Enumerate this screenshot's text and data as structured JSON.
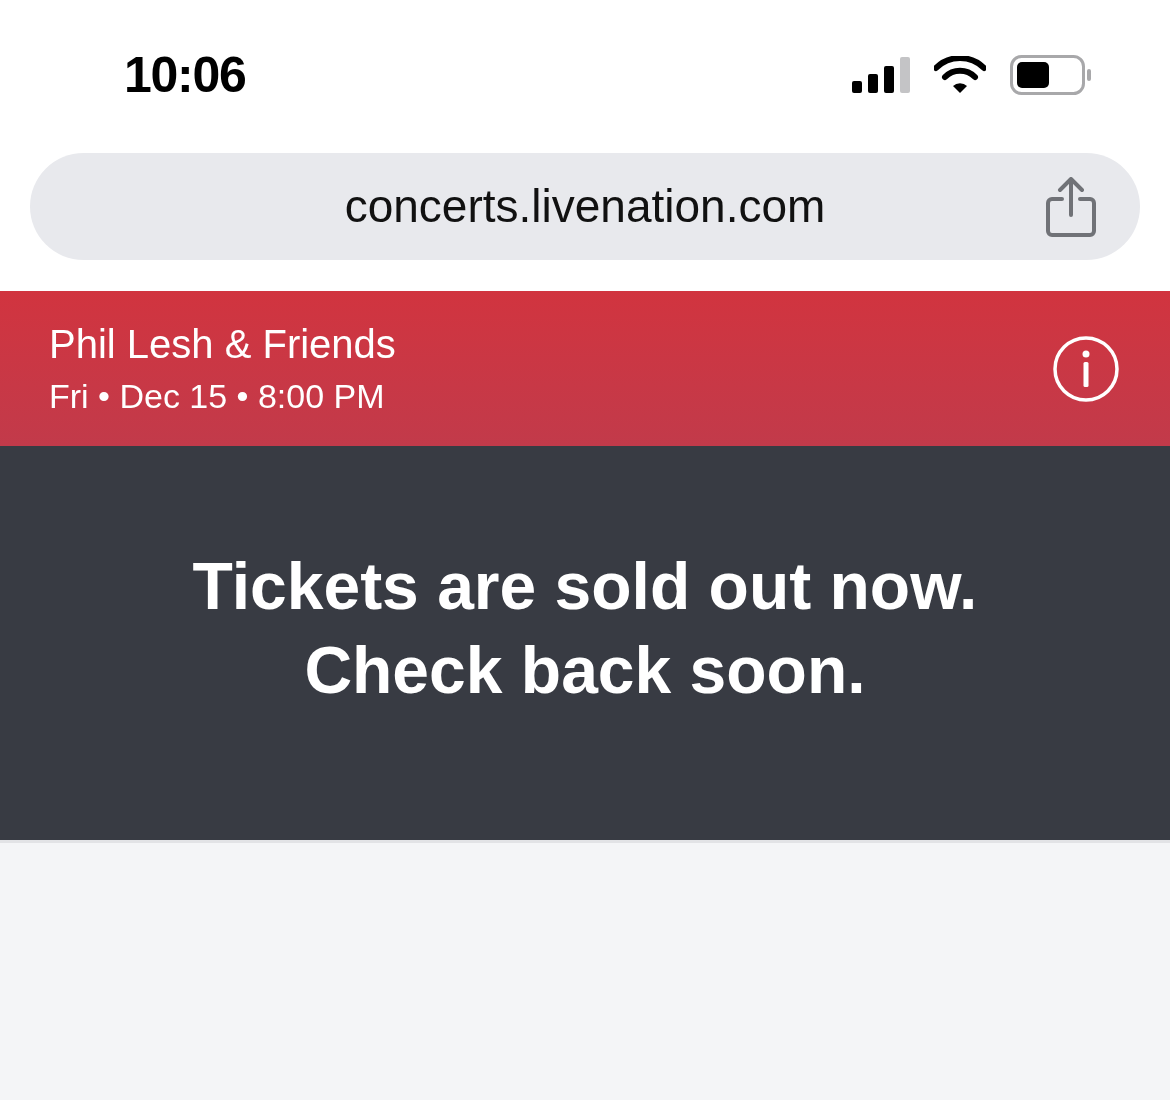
{
  "status_bar": {
    "time": "10:06"
  },
  "address_bar": {
    "url": "concerts.livenation.com"
  },
  "event": {
    "title": "Phil Lesh & Friends",
    "date_line": "Fri • Dec 15 • 8:00 PM"
  },
  "message": {
    "lines": [
      "Tickets are sold out now.",
      "Check back soon."
    ]
  }
}
